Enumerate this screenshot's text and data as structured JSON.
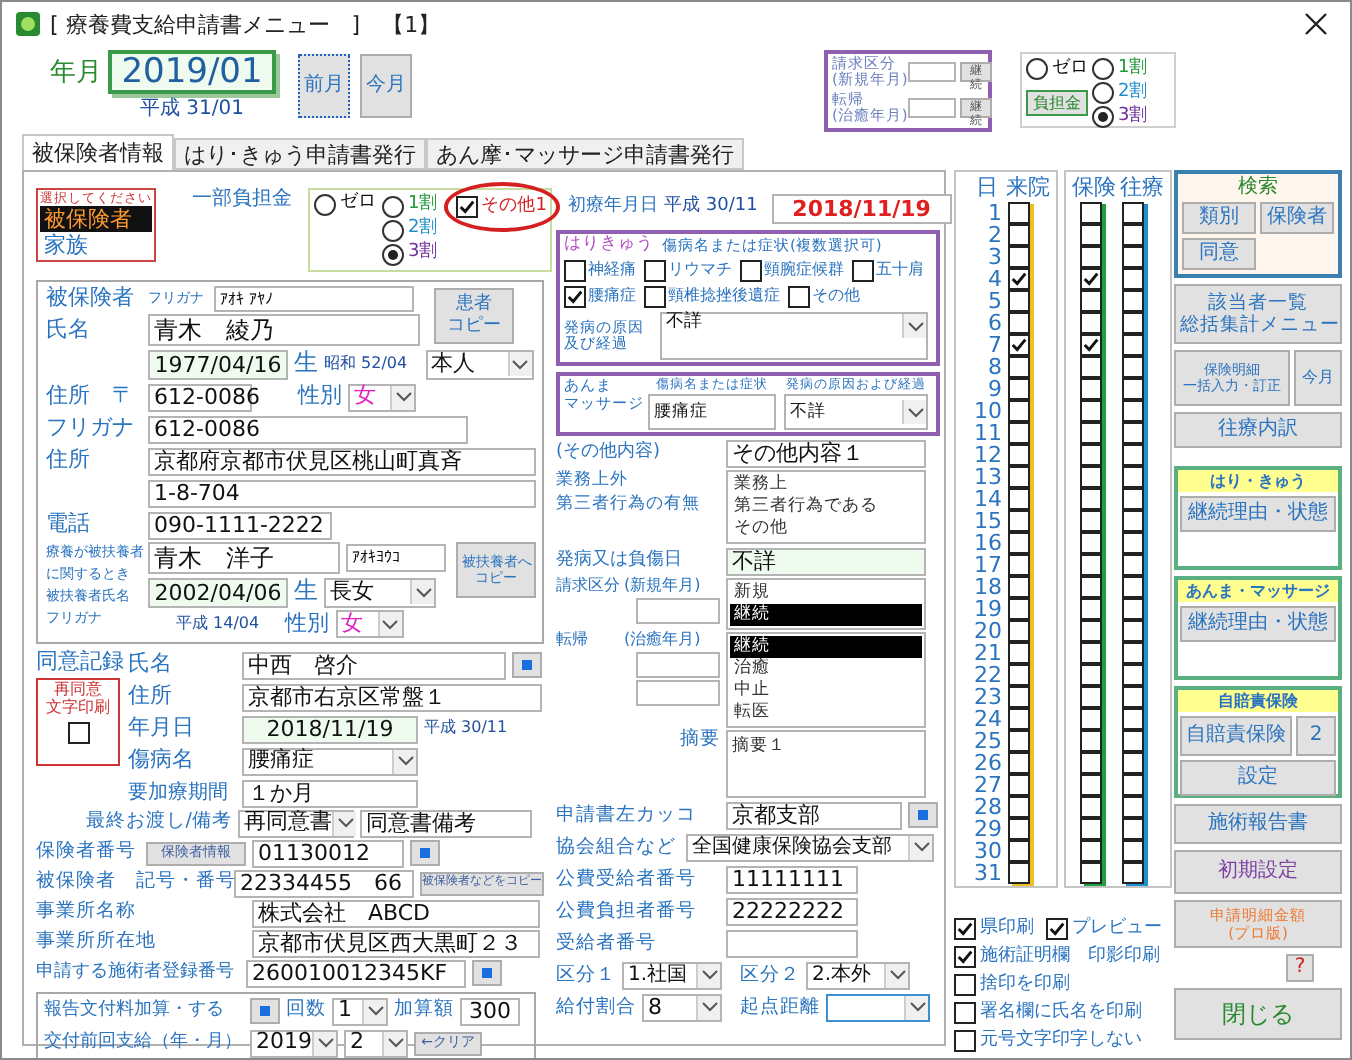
{
  "window": {
    "title": "[ 療養費支給申請書メニュー　]　【1】"
  },
  "period": {
    "label": "年月",
    "value": "2019/01",
    "era": "平成 31/01",
    "buttons": [
      {
        "label": "前月",
        "focused": true
      },
      {
        "label": "今月",
        "focused": false
      }
    ]
  },
  "claim_box": {
    "rows": [
      {
        "label": "請求区分",
        "note": "(新規年月)",
        "button": "継続"
      },
      {
        "label": "転帰",
        "note": "(治癒年月)",
        "button": "継続"
      }
    ]
  },
  "burden": {
    "button": "負担金",
    "options": [
      {
        "label": "ゼロ",
        "selected": false
      },
      {
        "label": "1割",
        "selected": false
      },
      {
        "label": "2割",
        "selected": false
      },
      {
        "label": "3割",
        "selected": true
      }
    ]
  },
  "tabs": [
    {
      "label": "被保険者情報",
      "selected": true
    },
    {
      "label": "はり･きゅう申請書発行",
      "selected": false
    },
    {
      "label": "あん摩･マッサージ申請書発行",
      "selected": false
    }
  ],
  "patient_type": {
    "title": "選択してください",
    "items": [
      {
        "label": "被保険者",
        "selected": true
      },
      {
        "label": "家族",
        "selected": false
      }
    ]
  },
  "copay": {
    "label": "一部負担金",
    "options": [
      {
        "label": "ゼロ",
        "selected": false
      },
      {
        "label": "1割",
        "selected": false
      },
      {
        "label": "2割",
        "selected": false
      },
      {
        "label": "3割",
        "selected": true
      }
    ],
    "other": {
      "label": "その他1",
      "checked": true,
      "circled": true
    }
  },
  "insured": {
    "label": "被保険者",
    "furigana_label": "フリガナ",
    "furigana": "ｱｵｷ ｱﾔﾉ",
    "name_label": "氏名",
    "name": "青木　綾乃",
    "copy_button": [
      "患者",
      "コピー"
    ],
    "birth": "1977/04/16",
    "birth_suffix": "生",
    "birth_era": "昭和 52/04",
    "relation": "本人",
    "postal_label": "住所　〒",
    "postal": "612-0086",
    "sex_label": "性別",
    "sex": "女",
    "kana_label": "フリガナ",
    "kana": "612-0086",
    "address_label": "住所",
    "address1": "京都府京都市伏見区桃山町真斉",
    "address2": "1-8-704",
    "phone_label": "電話",
    "phone": "090-1111-2222"
  },
  "dependent": {
    "labels": [
      "療養が被扶養者",
      "に関するとき",
      "被扶養者氏名",
      "フリガナ"
    ],
    "name": "青木　洋子",
    "kana": "ｱｵｷﾖｳｺ",
    "copy_button": [
      "被扶養者へ",
      "コピー"
    ],
    "birth": "2002/04/06",
    "birth_suffix": "生",
    "relation": "長女",
    "birth_era": "平成 14/04",
    "sex_label": "性別",
    "sex": "女"
  },
  "consent": {
    "label": "同意記録",
    "reprint_label": [
      "再同意",
      "文字印刷"
    ],
    "reprint_checked": false,
    "name_label": "氏名",
    "name": "中西　啓介",
    "address_label": "住所",
    "address": "京都市右京区常盤１",
    "date_label": "年月日",
    "date": "2018/11/19",
    "date_era": "平成 30/11",
    "disease_label": "傷病名",
    "disease": "腰痛症",
    "period_label": "要加療期間",
    "period": "１か月",
    "handover_label": "最終お渡し/備考",
    "handover": "再同意書",
    "note": "同意書備考"
  },
  "insurer": {
    "number_label": "保険者番号",
    "info_button": "保険者情報",
    "number": "01130012",
    "insured_label": "被保険者　記号・番号",
    "insured_number": "22334455　66",
    "copy_button": "被保険者などをコピー",
    "office_label": "事業所名称",
    "office": "株式会社　ABCD",
    "office_address_label": "事業所所在地",
    "office_address": "京都市伏見区西大黒町２３",
    "practitioner_label": "申請する施術者登録番号",
    "practitioner": "260010012345KF"
  },
  "report": {
    "label": "報告文付料加算・する",
    "count_label": "回数",
    "count": "1",
    "amount_label": "加算額",
    "amount": "300",
    "last_label": "交付前回支給（年・月）",
    "year": "2019",
    "month": "2",
    "clear_button": "←クリア"
  },
  "first_visit": {
    "label": "初療年月日",
    "era": "平成 30/11",
    "date": "2018/11/19"
  },
  "acupuncture": {
    "title": "はりきゅう",
    "subtitle": "傷病名または症状(複数選択可)",
    "conditions": [
      {
        "label": "神経痛",
        "checked": false
      },
      {
        "label": "リウマチ",
        "checked": false
      },
      {
        "label": "頸腕症候群",
        "checked": false
      },
      {
        "label": "五十肩",
        "checked": false
      },
      {
        "label": "腰痛症",
        "checked": true
      },
      {
        "label": "頸椎捻挫後遺症",
        "checked": false
      },
      {
        "label": "その他",
        "checked": false
      }
    ],
    "cause_label": [
      "発病の原因",
      "及び経過"
    ],
    "cause": "不詳"
  },
  "massage": {
    "title": [
      "あんま",
      "マッサージ"
    ],
    "disease_header": "傷病名または症状",
    "cause_header": "発病の原因および経過",
    "disease": "腰痛症",
    "cause": "不詳"
  },
  "other": {
    "label": "(その他内容)",
    "value": "その他内容１"
  },
  "work": {
    "labels": [
      "業務上外",
      "第三者行為の有無"
    ],
    "items": [
      {
        "label": "業務上",
        "selected": false
      },
      {
        "label": "第三者行為である",
        "selected": false
      },
      {
        "label": "その他",
        "selected": false
      }
    ]
  },
  "onset": {
    "label": "発病又は負傷日",
    "value": "不詳"
  },
  "claim": {
    "label": "請求区分",
    "note": "(新規年月)",
    "items": [
      {
        "label": "新規",
        "selected": false
      },
      {
        "label": "継続",
        "selected": true
      }
    ]
  },
  "outcome": {
    "label": "転帰",
    "note": "(治癒年月)",
    "items": [
      {
        "label": "継続",
        "selected": true
      },
      {
        "label": "治癒",
        "selected": false
      },
      {
        "label": "中止",
        "selected": false
      },
      {
        "label": "転医",
        "selected": false
      }
    ]
  },
  "summary": {
    "label": "摘要",
    "value": "摘要１"
  },
  "form_header": {
    "label": "申請書左カッコ",
    "value": "京都支部"
  },
  "association": {
    "label": "協会組合など",
    "value": "全国健康保険協会支部"
  },
  "public": {
    "recipient_label": "公費受給者番号",
    "recipient": "11111111",
    "payer_label": "公費負担者番号",
    "payer": "22222222",
    "beneficiary_label": "受給者番号"
  },
  "category": {
    "label1": "区分１",
    "value1": "1.社国",
    "label2": "区分２",
    "value2": "2.本外"
  },
  "benefit": {
    "label": "給付割合",
    "value": "8",
    "distance_label": "起点距離"
  },
  "calendar": {
    "headers": [
      "日",
      "来院",
      "保険",
      "往療"
    ],
    "days": [
      {
        "day": "1",
        "visit": false,
        "insurance": false,
        "travel": false
      },
      {
        "day": "2",
        "visit": false,
        "insurance": false,
        "travel": false
      },
      {
        "day": "3",
        "visit": false,
        "insurance": false,
        "travel": false
      },
      {
        "day": "4",
        "visit": true,
        "insurance": true,
        "travel": false
      },
      {
        "day": "5",
        "visit": false,
        "insurance": false,
        "travel": false
      },
      {
        "day": "6",
        "visit": false,
        "insurance": false,
        "travel": false
      },
      {
        "day": "7",
        "visit": true,
        "insurance": true,
        "travel": false
      },
      {
        "day": "8",
        "visit": false,
        "insurance": false,
        "travel": false
      },
      {
        "day": "9",
        "visit": false,
        "insurance": false,
        "travel": false
      },
      {
        "day": "10",
        "visit": false,
        "insurance": false,
        "travel": false
      },
      {
        "day": "11",
        "visit": false,
        "insurance": false,
        "travel": false
      },
      {
        "day": "12",
        "visit": false,
        "insurance": false,
        "travel": false
      },
      {
        "day": "13",
        "visit": false,
        "insurance": false,
        "travel": false
      },
      {
        "day": "14",
        "visit": false,
        "insurance": false,
        "travel": false
      },
      {
        "day": "15",
        "visit": false,
        "insurance": false,
        "travel": false
      },
      {
        "day": "16",
        "visit": false,
        "insurance": false,
        "travel": false
      },
      {
        "day": "17",
        "visit": false,
        "insurance": false,
        "travel": false
      },
      {
        "day": "18",
        "visit": false,
        "insurance": false,
        "travel": false
      },
      {
        "day": "19",
        "visit": false,
        "insurance": false,
        "travel": false
      },
      {
        "day": "20",
        "visit": false,
        "insurance": false,
        "travel": false
      },
      {
        "day": "21",
        "visit": false,
        "insurance": false,
        "travel": false
      },
      {
        "day": "22",
        "visit": false,
        "insurance": false,
        "travel": false
      },
      {
        "day": "23",
        "visit": false,
        "insurance": false,
        "travel": false
      },
      {
        "day": "24",
        "visit": false,
        "insurance": false,
        "travel": false
      },
      {
        "day": "25",
        "visit": false,
        "insurance": false,
        "travel": false
      },
      {
        "day": "26",
        "visit": false,
        "insurance": false,
        "travel": false
      },
      {
        "day": "27",
        "visit": false,
        "insurance": false,
        "travel": false
      },
      {
        "day": "28",
        "visit": false,
        "insurance": false,
        "travel": false
      },
      {
        "day": "29",
        "visit": false,
        "insurance": false,
        "travel": false
      },
      {
        "day": "30",
        "visit": false,
        "insurance": false,
        "travel": false
      },
      {
        "day": "31",
        "visit": false,
        "insurance": false,
        "travel": false
      }
    ]
  },
  "print_options": [
    {
      "label": "県印刷",
      "checked": true
    },
    {
      "label": "プレビュー",
      "checked": true
    },
    {
      "label": "施術証明欄　印影印刷",
      "checked": true
    },
    {
      "label": "捨印を印刷",
      "checked": false
    },
    {
      "label": "署名欄に氏名を印刷",
      "checked": false
    },
    {
      "label": "元号文字印字しない",
      "checked": false
    }
  ],
  "search": {
    "title": "検索",
    "buttons": [
      "類別",
      "保険者",
      "同意"
    ]
  },
  "menu_button": [
    "該当者一覧",
    "総括集計メニュー"
  ],
  "detail_button": [
    "保険明細",
    "一括入力・訂正"
  ],
  "month_button": "今月",
  "travel_button": "往療内訳",
  "groups": [
    {
      "title": "はり・きゅう",
      "buttons": [
        "継続理由・状態"
      ]
    },
    {
      "title": "あんま・マッサージ",
      "buttons": [
        "継続理由・状態"
      ]
    },
    {
      "title": "自賠責保険",
      "buttons": [
        "自賠責保険",
        "2",
        "設定"
      ]
    }
  ],
  "report_button": "施術報告書",
  "settings_button": "初期設定",
  "amount_button": [
    "申請明細金額",
    "(プロ版)"
  ],
  "help_button": "?",
  "close_button": "閉じる"
}
